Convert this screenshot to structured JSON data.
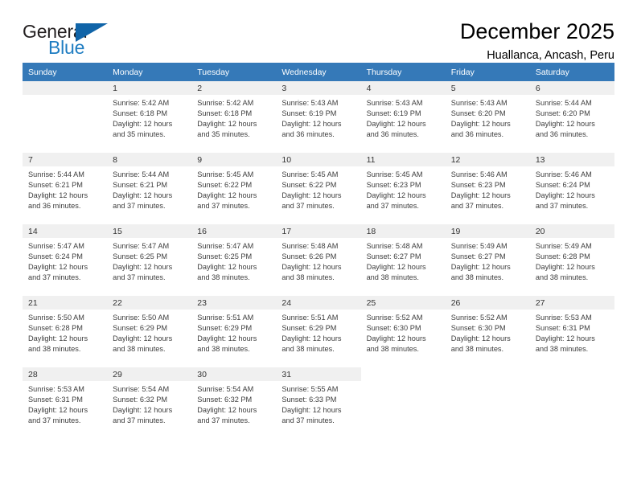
{
  "brand": {
    "name_part1": "General",
    "name_part2": "Blue",
    "logo_icon": "triangle-flag-mark",
    "accent_color": "#1f7dc2",
    "mark_color": "#1064a8"
  },
  "header": {
    "title": "December 2025",
    "subtitle": "Huallanca, Ancash, Peru"
  },
  "calendar": {
    "header_bg": "#3579b8",
    "daynum_bg": "#f0f0f0",
    "weekdays": [
      "Sunday",
      "Monday",
      "Tuesday",
      "Wednesday",
      "Thursday",
      "Friday",
      "Saturday"
    ],
    "weeks": [
      [
        {
          "day": "",
          "sunrise": "",
          "sunset": "",
          "daylight1": "",
          "daylight2": "",
          "empty": true
        },
        {
          "day": "1",
          "sunrise": "Sunrise: 5:42 AM",
          "sunset": "Sunset: 6:18 PM",
          "daylight1": "Daylight: 12 hours",
          "daylight2": "and 35 minutes."
        },
        {
          "day": "2",
          "sunrise": "Sunrise: 5:42 AM",
          "sunset": "Sunset: 6:18 PM",
          "daylight1": "Daylight: 12 hours",
          "daylight2": "and 35 minutes."
        },
        {
          "day": "3",
          "sunrise": "Sunrise: 5:43 AM",
          "sunset": "Sunset: 6:19 PM",
          "daylight1": "Daylight: 12 hours",
          "daylight2": "and 36 minutes."
        },
        {
          "day": "4",
          "sunrise": "Sunrise: 5:43 AM",
          "sunset": "Sunset: 6:19 PM",
          "daylight1": "Daylight: 12 hours",
          "daylight2": "and 36 minutes."
        },
        {
          "day": "5",
          "sunrise": "Sunrise: 5:43 AM",
          "sunset": "Sunset: 6:20 PM",
          "daylight1": "Daylight: 12 hours",
          "daylight2": "and 36 minutes."
        },
        {
          "day": "6",
          "sunrise": "Sunrise: 5:44 AM",
          "sunset": "Sunset: 6:20 PM",
          "daylight1": "Daylight: 12 hours",
          "daylight2": "and 36 minutes."
        }
      ],
      [
        {
          "day": "7",
          "sunrise": "Sunrise: 5:44 AM",
          "sunset": "Sunset: 6:21 PM",
          "daylight1": "Daylight: 12 hours",
          "daylight2": "and 36 minutes."
        },
        {
          "day": "8",
          "sunrise": "Sunrise: 5:44 AM",
          "sunset": "Sunset: 6:21 PM",
          "daylight1": "Daylight: 12 hours",
          "daylight2": "and 37 minutes."
        },
        {
          "day": "9",
          "sunrise": "Sunrise: 5:45 AM",
          "sunset": "Sunset: 6:22 PM",
          "daylight1": "Daylight: 12 hours",
          "daylight2": "and 37 minutes."
        },
        {
          "day": "10",
          "sunrise": "Sunrise: 5:45 AM",
          "sunset": "Sunset: 6:22 PM",
          "daylight1": "Daylight: 12 hours",
          "daylight2": "and 37 minutes."
        },
        {
          "day": "11",
          "sunrise": "Sunrise: 5:45 AM",
          "sunset": "Sunset: 6:23 PM",
          "daylight1": "Daylight: 12 hours",
          "daylight2": "and 37 minutes."
        },
        {
          "day": "12",
          "sunrise": "Sunrise: 5:46 AM",
          "sunset": "Sunset: 6:23 PM",
          "daylight1": "Daylight: 12 hours",
          "daylight2": "and 37 minutes."
        },
        {
          "day": "13",
          "sunrise": "Sunrise: 5:46 AM",
          "sunset": "Sunset: 6:24 PM",
          "daylight1": "Daylight: 12 hours",
          "daylight2": "and 37 minutes."
        }
      ],
      [
        {
          "day": "14",
          "sunrise": "Sunrise: 5:47 AM",
          "sunset": "Sunset: 6:24 PM",
          "daylight1": "Daylight: 12 hours",
          "daylight2": "and 37 minutes."
        },
        {
          "day": "15",
          "sunrise": "Sunrise: 5:47 AM",
          "sunset": "Sunset: 6:25 PM",
          "daylight1": "Daylight: 12 hours",
          "daylight2": "and 37 minutes."
        },
        {
          "day": "16",
          "sunrise": "Sunrise: 5:47 AM",
          "sunset": "Sunset: 6:25 PM",
          "daylight1": "Daylight: 12 hours",
          "daylight2": "and 38 minutes."
        },
        {
          "day": "17",
          "sunrise": "Sunrise: 5:48 AM",
          "sunset": "Sunset: 6:26 PM",
          "daylight1": "Daylight: 12 hours",
          "daylight2": "and 38 minutes."
        },
        {
          "day": "18",
          "sunrise": "Sunrise: 5:48 AM",
          "sunset": "Sunset: 6:27 PM",
          "daylight1": "Daylight: 12 hours",
          "daylight2": "and 38 minutes."
        },
        {
          "day": "19",
          "sunrise": "Sunrise: 5:49 AM",
          "sunset": "Sunset: 6:27 PM",
          "daylight1": "Daylight: 12 hours",
          "daylight2": "and 38 minutes."
        },
        {
          "day": "20",
          "sunrise": "Sunrise: 5:49 AM",
          "sunset": "Sunset: 6:28 PM",
          "daylight1": "Daylight: 12 hours",
          "daylight2": "and 38 minutes."
        }
      ],
      [
        {
          "day": "21",
          "sunrise": "Sunrise: 5:50 AM",
          "sunset": "Sunset: 6:28 PM",
          "daylight1": "Daylight: 12 hours",
          "daylight2": "and 38 minutes."
        },
        {
          "day": "22",
          "sunrise": "Sunrise: 5:50 AM",
          "sunset": "Sunset: 6:29 PM",
          "daylight1": "Daylight: 12 hours",
          "daylight2": "and 38 minutes."
        },
        {
          "day": "23",
          "sunrise": "Sunrise: 5:51 AM",
          "sunset": "Sunset: 6:29 PM",
          "daylight1": "Daylight: 12 hours",
          "daylight2": "and 38 minutes."
        },
        {
          "day": "24",
          "sunrise": "Sunrise: 5:51 AM",
          "sunset": "Sunset: 6:29 PM",
          "daylight1": "Daylight: 12 hours",
          "daylight2": "and 38 minutes."
        },
        {
          "day": "25",
          "sunrise": "Sunrise: 5:52 AM",
          "sunset": "Sunset: 6:30 PM",
          "daylight1": "Daylight: 12 hours",
          "daylight2": "and 38 minutes."
        },
        {
          "day": "26",
          "sunrise": "Sunrise: 5:52 AM",
          "sunset": "Sunset: 6:30 PM",
          "daylight1": "Daylight: 12 hours",
          "daylight2": "and 38 minutes."
        },
        {
          "day": "27",
          "sunrise": "Sunrise: 5:53 AM",
          "sunset": "Sunset: 6:31 PM",
          "daylight1": "Daylight: 12 hours",
          "daylight2": "and 38 minutes."
        }
      ],
      [
        {
          "day": "28",
          "sunrise": "Sunrise: 5:53 AM",
          "sunset": "Sunset: 6:31 PM",
          "daylight1": "Daylight: 12 hours",
          "daylight2": "and 37 minutes."
        },
        {
          "day": "29",
          "sunrise": "Sunrise: 5:54 AM",
          "sunset": "Sunset: 6:32 PM",
          "daylight1": "Daylight: 12 hours",
          "daylight2": "and 37 minutes."
        },
        {
          "day": "30",
          "sunrise": "Sunrise: 5:54 AM",
          "sunset": "Sunset: 6:32 PM",
          "daylight1": "Daylight: 12 hours",
          "daylight2": "and 37 minutes."
        },
        {
          "day": "31",
          "sunrise": "Sunrise: 5:55 AM",
          "sunset": "Sunset: 6:33 PM",
          "daylight1": "Daylight: 12 hours",
          "daylight2": "and 37 minutes."
        },
        {
          "day": "",
          "sunrise": "",
          "sunset": "",
          "daylight1": "",
          "daylight2": "",
          "blank": true
        },
        {
          "day": "",
          "sunrise": "",
          "sunset": "",
          "daylight1": "",
          "daylight2": "",
          "blank": true
        },
        {
          "day": "",
          "sunrise": "",
          "sunset": "",
          "daylight1": "",
          "daylight2": "",
          "blank": true
        }
      ]
    ]
  }
}
